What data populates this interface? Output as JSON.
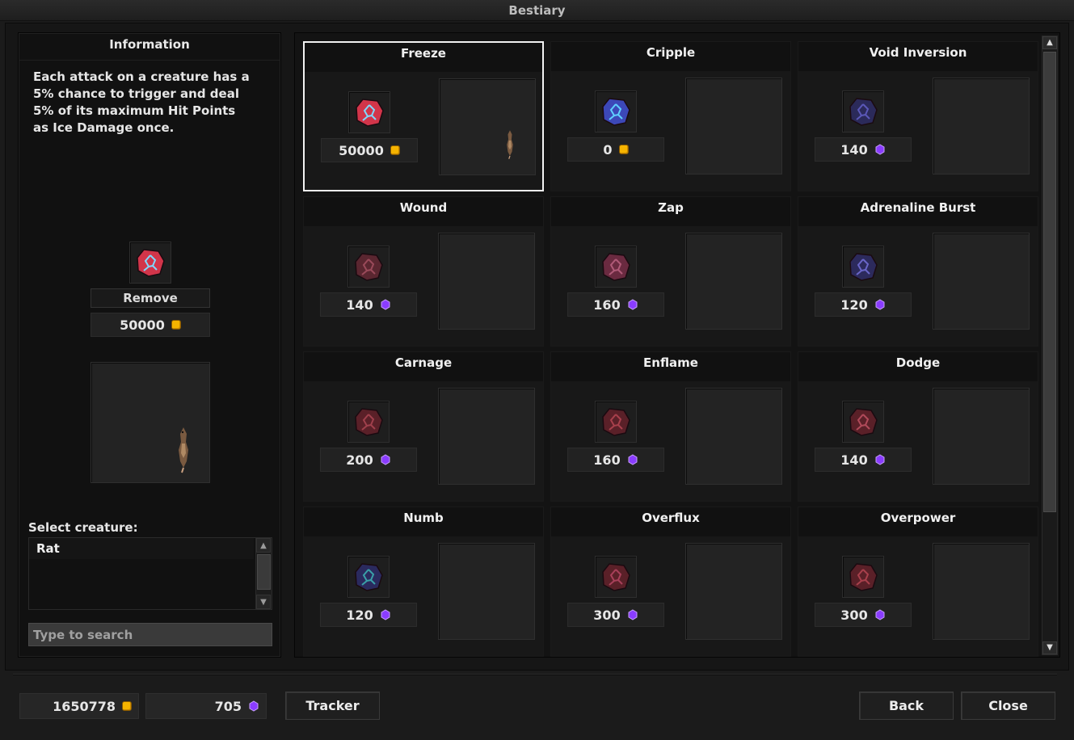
{
  "window": {
    "title": "Bestiary"
  },
  "info": {
    "header": "Information",
    "description": "Each attack on a creature has a\n5% chance to trigger and deal\n5% of its maximum Hit Points\nas Ice Damage once.",
    "selected_icon": "freeze-rune-icon",
    "remove_label": "Remove",
    "price": "50000",
    "price_currency": "gold-coin-icon",
    "select_label": "Select creature:",
    "creatures": [
      "Rat"
    ],
    "search_placeholder": "Type to search"
  },
  "charms": [
    {
      "name": "Freeze",
      "price": "50000",
      "currency": "gold",
      "icon": "freeze-rune-icon",
      "color": "#d2354a",
      "glyph": "#7fd8ff",
      "selected": true,
      "has_creature": true
    },
    {
      "name": "Cripple",
      "price": "0",
      "currency": "gold",
      "icon": "cripple-rune-icon",
      "color": "#3c48b8",
      "glyph": "#5fd0ff",
      "selected": false,
      "has_creature": false
    },
    {
      "name": "Void Inversion",
      "price": "140",
      "currency": "gem",
      "icon": "void-inversion-rune-icon",
      "color": "#2b2a5a",
      "glyph": "#5b58b8",
      "selected": false,
      "has_creature": false
    },
    {
      "name": "Wound",
      "price": "140",
      "currency": "gem",
      "icon": "wound-rune-icon",
      "color": "#5a2630",
      "glyph": "#9a4a5a",
      "selected": false,
      "has_creature": false
    },
    {
      "name": "Zap",
      "price": "160",
      "currency": "gem",
      "icon": "zap-rune-icon",
      "color": "#6a2a40",
      "glyph": "#b05a78",
      "selected": false,
      "has_creature": false
    },
    {
      "name": "Adrenaline Burst",
      "price": "120",
      "currency": "gem",
      "icon": "adrenaline-burst-rune-icon",
      "color": "#2c2a5c",
      "glyph": "#6a66c8",
      "selected": false,
      "has_creature": false
    },
    {
      "name": "Carnage",
      "price": "200",
      "currency": "gem",
      "icon": "carnage-rune-icon",
      "color": "#5a2028",
      "glyph": "#a0404c",
      "selected": false,
      "has_creature": false
    },
    {
      "name": "Enflame",
      "price": "160",
      "currency": "gem",
      "icon": "enflame-rune-icon",
      "color": "#5a2028",
      "glyph": "#a8404c",
      "selected": false,
      "has_creature": false
    },
    {
      "name": "Dodge",
      "price": "140",
      "currency": "gem",
      "icon": "dodge-rune-icon",
      "color": "#5a2028",
      "glyph": "#b04a5a",
      "selected": false,
      "has_creature": false
    },
    {
      "name": "Numb",
      "price": "120",
      "currency": "gem",
      "icon": "numb-rune-icon",
      "color": "#2a2a5e",
      "glyph": "#3aa0a8",
      "selected": false,
      "has_creature": false
    },
    {
      "name": "Overflux",
      "price": "300",
      "currency": "gem",
      "icon": "overflux-rune-icon",
      "color": "#5a2028",
      "glyph": "#a8405a",
      "selected": false,
      "has_creature": false
    },
    {
      "name": "Overpower",
      "price": "300",
      "currency": "gem",
      "icon": "overpower-rune-icon",
      "color": "#5a2028",
      "glyph": "#a8404c",
      "selected": false,
      "has_creature": false
    }
  ],
  "footer": {
    "gold": "1650778",
    "gems": "705",
    "tracker_label": "Tracker",
    "back_label": "Back",
    "close_label": "Close"
  },
  "colors": {
    "gold": "#f6b400",
    "gem": "#8a3cff",
    "selection_border": "#f2f2f2"
  }
}
